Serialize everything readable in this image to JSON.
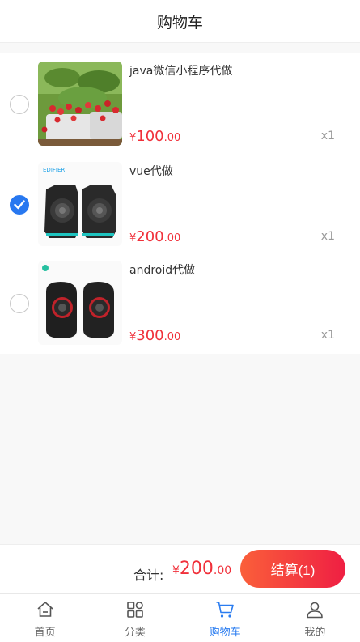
{
  "header": {
    "title": "购物车"
  },
  "cart": {
    "items": [
      {
        "name": "java微信小程序代做",
        "currency": "¥",
        "price_int": "100",
        "price_dec": ".00",
        "qty": "x1",
        "selected": false,
        "image": "strawberry-plant-photo"
      },
      {
        "name": "vue代做",
        "currency": "¥",
        "price_int": "200",
        "price_dec": ".00",
        "qty": "x1",
        "selected": true,
        "image": "edifier-speakers-photo",
        "brand_text": "EDIFIER"
      },
      {
        "name": "android代做",
        "currency": "¥",
        "price_int": "300",
        "price_dec": ".00",
        "qty": "x1",
        "selected": false,
        "image": "black-speakers-photo"
      }
    ]
  },
  "footer": {
    "total_label": "合计:",
    "currency": "¥",
    "total_int": "200",
    "total_dec": ".00",
    "checkout_label": "结算(1)"
  },
  "tabbar": {
    "tabs": [
      {
        "label": "首页",
        "icon": "home-icon"
      },
      {
        "label": "分类",
        "icon": "grid-icon"
      },
      {
        "label": "购物车",
        "icon": "cart-icon",
        "active": true
      },
      {
        "label": "我的",
        "icon": "user-icon"
      }
    ]
  },
  "colors": {
    "accent": "#2a7cf0",
    "price": "#f0303a",
    "checkout_start": "#fa5f3a",
    "checkout_end": "#ef1f43"
  }
}
